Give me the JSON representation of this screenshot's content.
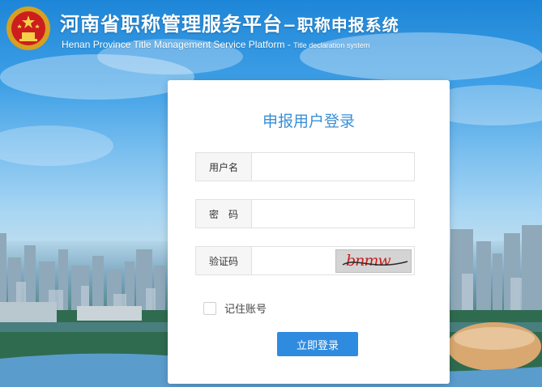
{
  "header": {
    "title_cn_main": "河南省职称管理服务平台",
    "title_cn_sub": "−职称申报系统",
    "title_en_main": "Henan Province Title Management Service Platform - ",
    "title_en_sub": "Title declaration system"
  },
  "login": {
    "title": "申报用户登录",
    "username_label": "用户名",
    "username_value": "",
    "password_label": "密　码",
    "password_value": "",
    "captcha_label": "验证码",
    "captcha_value": "",
    "captcha_text": "bnmw",
    "remember_label": "记住账号",
    "remember_checked": false,
    "submit_label": "立即登录"
  },
  "colors": {
    "accent": "#2f8be0",
    "title_blue": "#3a8fd6",
    "captcha_red": "#c8201e"
  },
  "icons": [
    "national-emblem-icon",
    "checkbox-icon"
  ]
}
